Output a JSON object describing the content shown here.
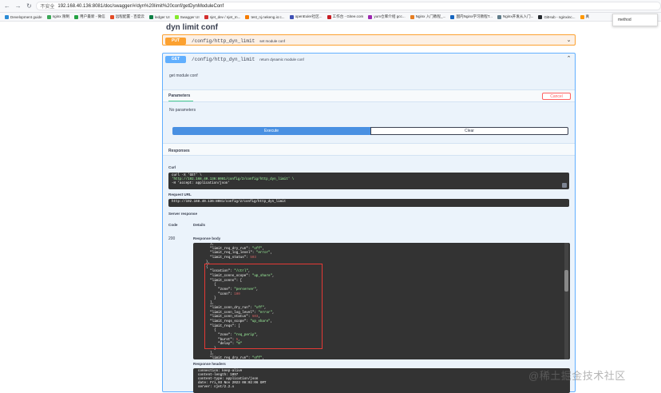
{
  "browser": {
    "address_warning": "不安全",
    "address_url": "192.168.40.136:8081/doc/swagger/#/dyn%20limit%20conf/getDynModuleConf",
    "bookmarks": [
      {
        "label": "Development guide",
        "color": "#2a8ad4"
      },
      {
        "label": "nginx 限制",
        "color": "#3aa757"
      },
      {
        "label": "用户最新 - 微信",
        "color": "#25a244"
      },
      {
        "label": "远程配置 - 百度云",
        "color": "#e34c26"
      },
      {
        "label": "ledger UI",
        "color": "#0d7f45"
      },
      {
        "label": "Swagger UI",
        "color": "#85ea2d"
      },
      {
        "label": "njet_dev / njet_m...",
        "color": "#d32f2f"
      },
      {
        "label": "test_nj.nekeng.io:c...",
        "color": "#f57c00"
      },
      {
        "label": "openEuler社区...",
        "color": "#3f51b5"
      },
      {
        "label": "工作台 - Gitee.com",
        "color": "#c71d23"
      },
      {
        "label": "yum仓库介绍 gcc...",
        "color": "#9c27b0"
      },
      {
        "label": "Nginx 入门教程_...",
        "color": "#e67e22"
      },
      {
        "label": "国内Nginx学习教程T...",
        "color": "#1565c0"
      },
      {
        "label": "Nginx开发从入门...",
        "color": "#607d8b"
      },
      {
        "label": "GitHub - nginxinc...",
        "color": "#24292e"
      },
      {
        "label": "真",
        "color": "#ff9800"
      }
    ],
    "find_text": "method"
  },
  "doc": {
    "title": "dyn limit conf",
    "put_block": {
      "method": "PUT",
      "path": "/config/http_dyn_limit",
      "summary": "set module conf",
      "color": "#fca130"
    },
    "get_block": {
      "method": "GET",
      "path": "/config/http_dyn_limit",
      "summary": "return dynamic module conf",
      "description": "get module conf",
      "color": "#61affe",
      "parameters_tab": "Parameters",
      "cancel_label": "Cancel",
      "no_params": "No parameters",
      "execute_label": "Execute",
      "clear_label": "Clear",
      "responses_heading": "Responses",
      "curl_label": "Curl",
      "curl_lines": [
        "curl -X 'GET' \\",
        "  'http://192.168.40.136:8081/config/2/config/http_dyn_limit' \\",
        "  -H 'accept: application/json'"
      ],
      "request_url_label": "Request URL",
      "request_url": "http://192.168.40.136:8081/config/2/config/http_dyn_limit",
      "server_response_label": "Server response",
      "code_header": "Code",
      "details_header": "Details",
      "code_value": "200",
      "response_body_label": "Response body",
      "download_label": "Download",
      "response_headers_label": "Response headers",
      "response_headers_lines": [
        " connection: keep-alive",
        " content-length: 1097",
        " content-type: application/json",
        " date: Fri,03 Nov 2023 08:02:06 GMT",
        " server: njet/2.2.x"
      ]
    }
  },
  "watermark": "@稀土掘金技术社区"
}
